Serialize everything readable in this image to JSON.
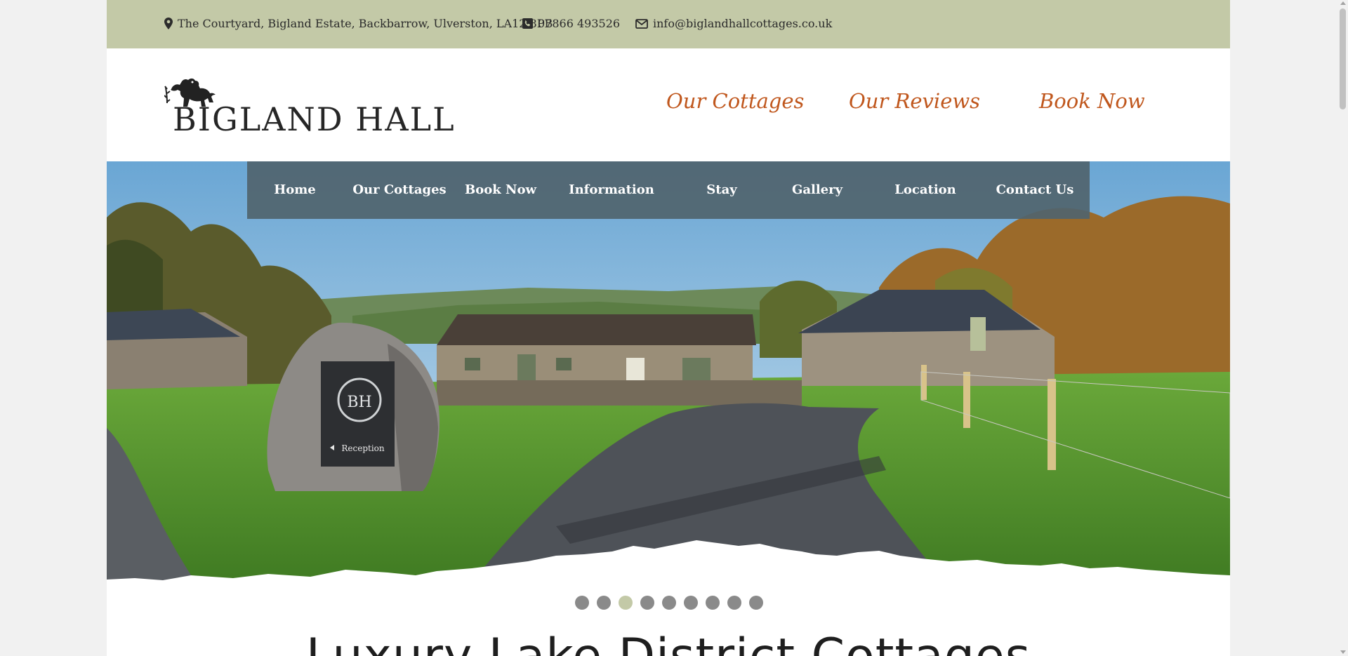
{
  "topbar": {
    "address": "The Courtyard, Bigland Estate, Backbarrow, Ulverston, LA12 8PB",
    "phone": "07866 493526",
    "email": "info@biglandhallcottages.co.uk"
  },
  "header": {
    "logo_text": "BIGLAND HALL",
    "links": [
      "Our Cottages",
      "Our Reviews",
      "Book Now"
    ]
  },
  "nav": {
    "items": [
      "Home",
      "Our Cottages",
      "Book Now",
      "Information",
      "Stay",
      "Gallery",
      "Location",
      "Contact Us"
    ]
  },
  "hero": {
    "sign_monogram": "BH",
    "sign_label": "Reception"
  },
  "slider": {
    "count": 9,
    "active_index": 2
  },
  "main": {
    "heading": "Luxury Lake District Cottages"
  },
  "colors": {
    "topbar": "#c3c9a7",
    "accent": "#c0571d",
    "nav": "#50646e"
  }
}
